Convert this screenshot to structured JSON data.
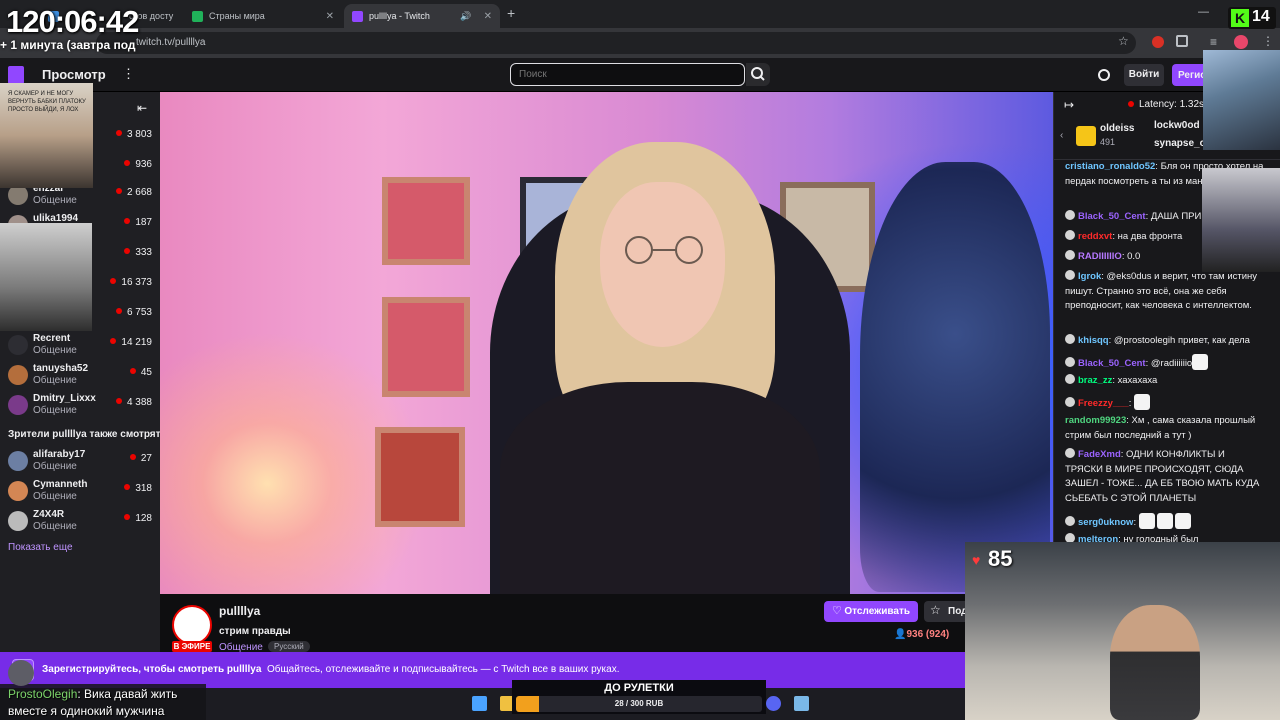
{
  "overlay": {
    "clock": "120:06:42",
    "clock_sub": "+ 1 минута (завтра под",
    "kick_count": "14",
    "heart_count": "85",
    "cam_tl_text": "Я СКАМЕР И НЕ МОГУ ВЕРНУТЬ БАБКИ ПЛАТОКУ ПРОСТО ВЫЙДИ, Я ЛОХ",
    "bottom_msg_name": "ProstoOlegih",
    "bottom_msg_text": "Вика давай жить вместе я одинокий мужчина",
    "roulette_title": "ДО РУЛЕТКИ",
    "roulette_progress": "28 / 300 RUB",
    "roulette_fraction": 0.093
  },
  "browser": {
    "tabs": [
      {
        "label": "стов досту",
        "active": false,
        "color": "#3c8dde"
      },
      {
        "label": "Страны мира",
        "active": false,
        "color": "#20b15a"
      },
      {
        "label": "pullllya - Twitch",
        "active": true,
        "color": "#9147ff"
      }
    ],
    "address": "twitch.tv/pullllya",
    "new_tab": "+"
  },
  "nav": {
    "browse": "Просмотр",
    "more": "⋮",
    "search_placeholder": "Поиск",
    "login": "Войти",
    "signup": "Регистрация"
  },
  "sidebar": {
    "collapse": "⇤",
    "followed": [
      {
        "name": "",
        "category": "",
        "viewers": "3 803",
        "color": "#6b5b55"
      },
      {
        "name": "",
        "category": "",
        "viewers": "936",
        "color": "#76706a"
      },
      {
        "name": "enzzai",
        "category": "Общение",
        "viewers": "2 668",
        "color": "#847b70"
      },
      {
        "name": "ulika1994",
        "category": "",
        "viewers": "187",
        "color": "#a0908a"
      },
      {
        "name": "",
        "category": "",
        "viewers": "333",
        "color": "#444"
      },
      {
        "name": "",
        "category": "",
        "viewers": "16 373",
        "color": "#555"
      },
      {
        "name": "",
        "category": "",
        "viewers": "6 753",
        "color": "#666"
      },
      {
        "name": "Recrent",
        "category": "Общение",
        "viewers": "14 219",
        "color": "#2d2d33"
      },
      {
        "name": "tanuysha52",
        "category": "Общение",
        "viewers": "45",
        "color": "#b46e3c"
      },
      {
        "name": "Dmitry_Lixxx",
        "category": "Общение",
        "viewers": "4 388",
        "color": "#7a3a8a"
      }
    ],
    "also_watch_header": "Зрители pullllya также смотрят",
    "also_watch": [
      {
        "name": "alifaraby17",
        "category": "Общение",
        "viewers": "27",
        "color": "#6c7fa3"
      },
      {
        "name": "Cymanneth",
        "category": "Общение",
        "viewers": "318",
        "color": "#d38654"
      },
      {
        "name": "Z4X4R",
        "category": "Общение",
        "viewers": "128",
        "color": "#bbbbbb"
      }
    ],
    "show_more": "Показать еще"
  },
  "stream": {
    "name": "pullllya",
    "title": "стрим правды",
    "category": "Общение",
    "tag": "Русский",
    "live": "В ЭФИРЕ",
    "follow": "Отслеживать",
    "subscribe": "Подписаться",
    "viewers": "936 (924)"
  },
  "banner": {
    "bold": "Зарегистрируйтесь, чтобы смотреть pullllya",
    "text": "Общайтесь, отслеживайте и подписывайтесь — с Twitch все в ваших руках."
  },
  "chat": {
    "collapse": "↦",
    "latency": "Latency: 1.32s",
    "gifters": [
      {
        "name": "oldeiss",
        "count": "491"
      },
      {
        "name": "lockw0od",
        "count": ""
      },
      {
        "name": "synapse_o",
        "count": ""
      }
    ],
    "messages": [
      {
        "user": "cristiano_ronaldo52",
        "color": "#6fc6ff",
        "text": "Бля он просто хотел на пердак посмотреть а ты из маньяка делаешь"
      },
      {
        "user": "Black_50_Cent",
        "color": "#9b63ff",
        "text": "ДАША ПРИВЕТ"
      },
      {
        "user": "reddxvt",
        "color": "#ff2a2a",
        "text": "на два фронта"
      },
      {
        "user": "RADIIIIIIO",
        "color": "#b678ff",
        "text": "0.0"
      },
      {
        "user": "Igrok",
        "color": "#6fc6ff",
        "text": "@eks0dus и верит, что там истину пишут. Странно это всё, она же себя преподносит, как человека с интеллектом."
      },
      {
        "user": "khisqq",
        "color": "#6fc6ff",
        "text": "@prostoolegih привет, как дела"
      },
      {
        "user": "Black_50_Cent",
        "color": "#9b63ff",
        "text": "@radiiiiiio"
      },
      {
        "user": "braz_zz",
        "color": "#00ff7f",
        "text": "хахахаха"
      },
      {
        "user": "Freezzy___",
        "color": "#ff2a2a",
        "text": ""
      },
      {
        "user": "random99923",
        "color": "#4fd47f",
        "text": "Хм , сама сказала прошлый стрим был последний а тут )"
      },
      {
        "user": "FadeXmd",
        "color": "#9b63ff",
        "text": "ОДНИ КОНФЛИКТЫ И ТРЯСКИ В МИРЕ ПРОИСХОДЯТ, СЮДА ЗАШЕЛ - ТОЖЕ... ДА ЕБ ТВОЮ МАТЬ КУДА СЬЕБАТЬ С ЭТОЙ ПЛАНЕТЫ"
      },
      {
        "user": "serg0uknow",
        "color": "#6fc6ff",
        "text": ""
      },
      {
        "user": "melteron",
        "color": "#6fc6ff",
        "text": "ну голодный был"
      }
    ]
  }
}
